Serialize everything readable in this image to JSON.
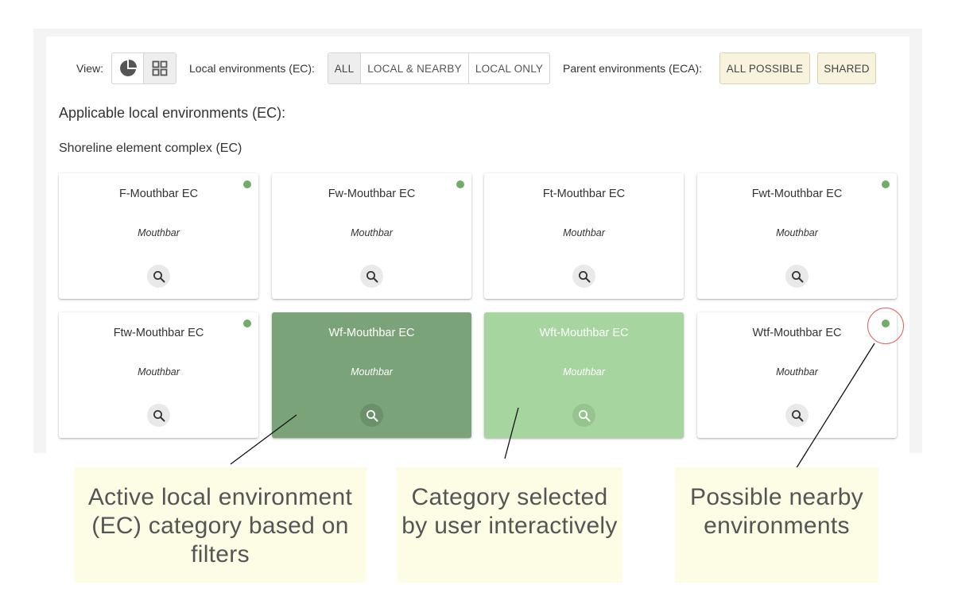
{
  "toolbar": {
    "view_label": "View:",
    "view_icons": [
      "pie-chart-icon",
      "grid-icon"
    ],
    "local_label": "Local environments (EC):",
    "local_options": [
      "ALL",
      "LOCAL & NEARBY",
      "LOCAL ONLY"
    ],
    "local_selected": "ALL",
    "parent_label": "Parent environments (ECA):",
    "parent_options": [
      "ALL POSSIBLE",
      "SHARED"
    ]
  },
  "heading": "Applicable local environments (EC):",
  "group_title": "Shoreline element complex (EC)",
  "cards": [
    {
      "title": "F-Mouthbar EC",
      "subtitle": "Mouthbar",
      "state": "default",
      "nearby": true
    },
    {
      "title": "Fw-Mouthbar EC",
      "subtitle": "Mouthbar",
      "state": "default",
      "nearby": true
    },
    {
      "title": "Ft-Mouthbar EC",
      "subtitle": "Mouthbar",
      "state": "default",
      "nearby": false
    },
    {
      "title": "Fwt-Mouthbar EC",
      "subtitle": "Mouthbar",
      "state": "default",
      "nearby": true
    },
    {
      "title": "Ftw-Mouthbar EC",
      "subtitle": "Mouthbar",
      "state": "default",
      "nearby": true
    },
    {
      "title": "Wf-Mouthbar EC",
      "subtitle": "Mouthbar",
      "state": "active",
      "nearby": false
    },
    {
      "title": "Wft-Mouthbar EC",
      "subtitle": "Mouthbar",
      "state": "selected",
      "nearby": false
    },
    {
      "title": "Wtf-Mouthbar EC",
      "subtitle": "Mouthbar",
      "state": "default",
      "nearby": true
    }
  ],
  "callouts": {
    "active": "Active local environment (EC) category based on filters",
    "selected": "Category selected by user interactively",
    "nearby": "Possible nearby environments"
  },
  "colors": {
    "active_card": "#7ba37a",
    "selected_card": "#a7d5a0",
    "nearby_dot": "#74ab6a",
    "parent_button": "#f7f3dc",
    "callout_bg": "#fdfde6",
    "highlight_circle": "#e06060"
  }
}
